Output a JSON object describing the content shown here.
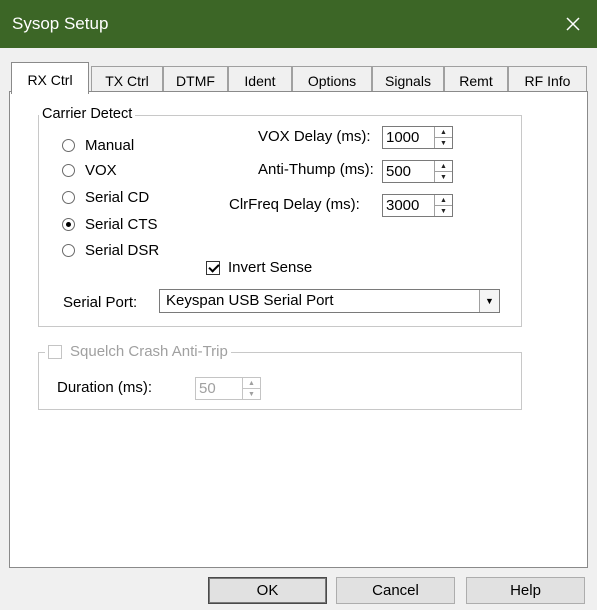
{
  "window": {
    "title": "Sysop Setup",
    "close_glyph": "✕"
  },
  "tabs": [
    {
      "label": "RX Ctrl",
      "active": true
    },
    {
      "label": "TX Ctrl"
    },
    {
      "label": "DTMF"
    },
    {
      "label": "Ident"
    },
    {
      "label": "Options"
    },
    {
      "label": "Signals"
    },
    {
      "label": "Remt"
    },
    {
      "label": "RF Info"
    }
  ],
  "carrier_detect": {
    "title": "Carrier Detect",
    "options": [
      "Manual",
      "VOX",
      "Serial CD",
      "Serial CTS",
      "Serial DSR"
    ],
    "selected": "Serial CTS",
    "vox_delay": {
      "label": "VOX Delay (ms):",
      "value": "1000"
    },
    "anti_thump": {
      "label": "Anti-Thump (ms):",
      "value": "500"
    },
    "clrfreq_delay": {
      "label": "ClrFreq Delay (ms):",
      "value": "3000"
    },
    "invert_sense": {
      "label": "Invert Sense",
      "checked": true
    },
    "serial_port": {
      "label": "Serial Port:",
      "value": "Keyspan USB Serial Port",
      "arrow": "▼"
    }
  },
  "squelch": {
    "title": "Squelch Crash Anti-Trip",
    "checked": false,
    "enabled": false,
    "duration": {
      "label": "Duration (ms):",
      "value": "50"
    }
  },
  "spin_arrows": {
    "up": "▲",
    "down": "▼"
  },
  "buttons": {
    "ok": "OK",
    "cancel": "Cancel",
    "help": "Help"
  }
}
